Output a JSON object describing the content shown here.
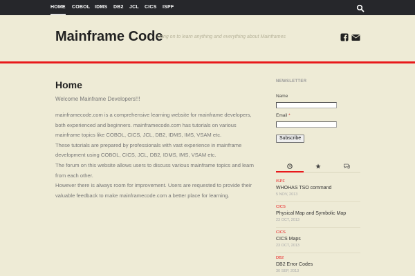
{
  "nav": {
    "items": [
      {
        "label": "Home",
        "active": true
      },
      {
        "label": "COBOL"
      },
      {
        "label": "IDMS"
      },
      {
        "label": "DB2"
      },
      {
        "label": "JCL"
      },
      {
        "label": "CICS"
      },
      {
        "label": "ISPF"
      }
    ],
    "search_icon": "search-icon"
  },
  "header": {
    "title": "Mainframe Code",
    "description": "Hang on to learn anything and everything about Mainframes",
    "social_icons": [
      "facebook-icon",
      "envelope-icon"
    ]
  },
  "colors": {
    "accent": "#e8191b",
    "nav_bg": "#26272b",
    "page_bg": "#eeebd6"
  },
  "main": {
    "title": "Home",
    "welcome": "Welcome Mainframe Developers!!!",
    "paragraphs": [
      "mainframecode.com is a comprehensive learning website for mainframe developers, both experienced and beginners. mainframecode.com has tutorials on various mainframe topics like COBOL, CICS, JCL, DB2, IDMS, IMS, VSAM etc.",
      "These tutorials are prepared by professionals with vast experience in mainframe development using COBOL, CICS, JCL, DB2, IDMS, IMS, VSAM etc.",
      "The forum on this website allows users to discuss various mainframe topics and learn from each other.",
      "However there is always room for improvement. Users are requested to provide their valuable feedback to make mainframecode.com a better place for learning."
    ]
  },
  "sidebar": {
    "newsletter": {
      "title": "Newsletter",
      "name_label": "Name",
      "email_label": "Email",
      "required_mark": "*",
      "subscribe_label": "Subscribe"
    },
    "tabs": [
      {
        "icon": "clock-icon",
        "active": true
      },
      {
        "icon": "star-icon"
      },
      {
        "icon": "comments-icon"
      }
    ],
    "posts": [
      {
        "category": "ISPF",
        "title": "WHOHAS TSO command",
        "date": "5 Nov, 2013"
      },
      {
        "category": "CICS",
        "title": "Physical Map and Symbolic Map",
        "date": "23 Oct, 2013"
      },
      {
        "category": "CICS",
        "title": "CICS Maps",
        "date": "23 Oct, 2013"
      },
      {
        "category": "DB2",
        "title": "DB2 Error Codes",
        "date": "30 Sep, 2013"
      }
    ]
  }
}
